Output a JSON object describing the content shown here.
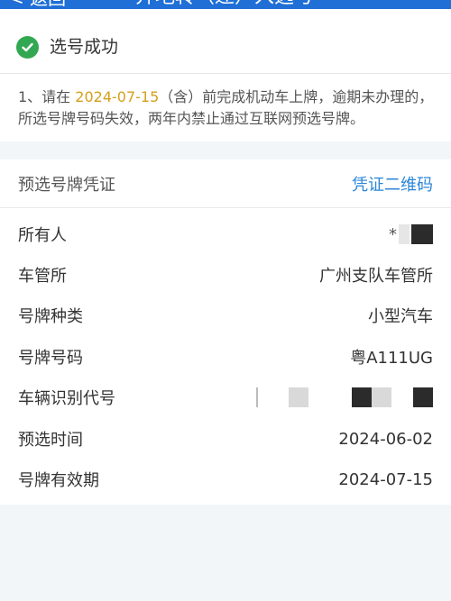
{
  "nav": {
    "back_label": "< 返回",
    "title": "异地转（迁）入选号"
  },
  "status": {
    "title": "选号成功",
    "notice_prefix": "1、请在 ",
    "notice_date": "2024-07-15",
    "notice_suffix": "（含）前完成机动车上牌，逾期未办理的，所选号牌号码失效，两年内禁止通过互联网预选号牌。"
  },
  "certificate": {
    "label": "预选号牌凭证",
    "link_label": "凭证二维码"
  },
  "details": [
    {
      "label": "所有人",
      "value": "*"
    },
    {
      "label": "车管所",
      "value": "广州支队车管所"
    },
    {
      "label": "号牌种类",
      "value": "小型汽车"
    },
    {
      "label": "号牌号码",
      "value": "粤A111UG"
    },
    {
      "label": "车辆识别代号",
      "value": ""
    },
    {
      "label": "预选时间",
      "value": "2024-06-02"
    },
    {
      "label": "号牌有效期",
      "value": "2024-07-15"
    }
  ],
  "colors": {
    "brand_blue": "#1f6fd6",
    "success_green": "#33a852",
    "link_blue": "#2a86d8",
    "date_highlight": "#d4a01c"
  }
}
